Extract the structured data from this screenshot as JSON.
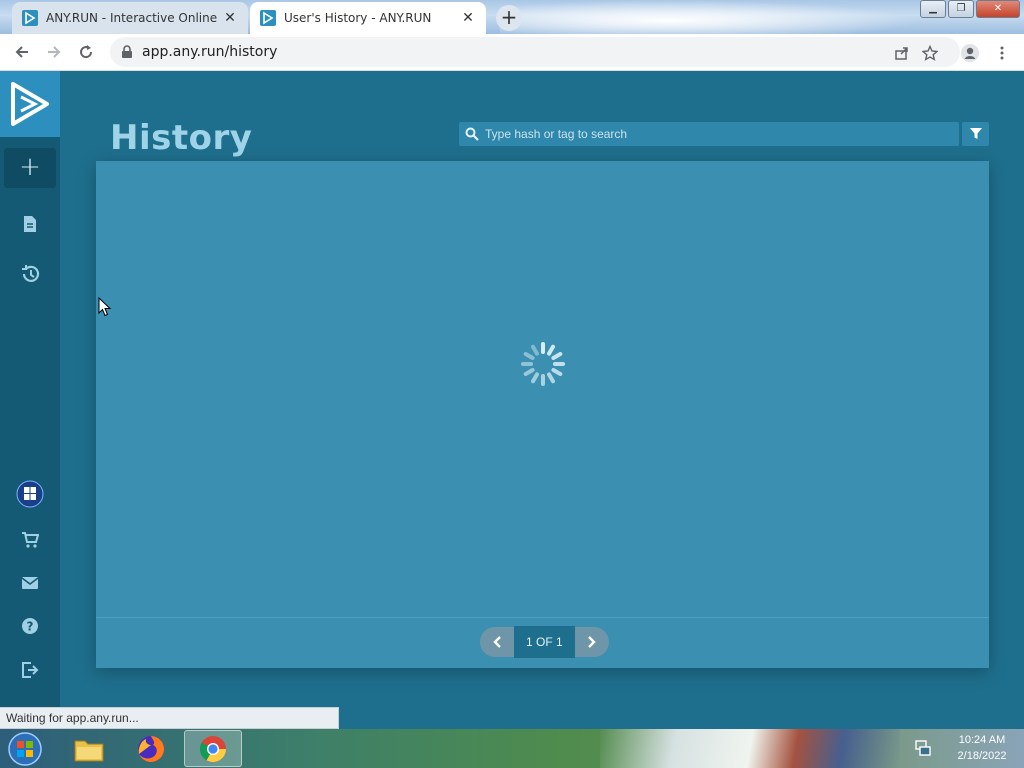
{
  "browser": {
    "tabs": [
      {
        "title": "ANY.RUN - Interactive Online Ma",
        "active": false
      },
      {
        "title": "User's History - ANY.RUN",
        "active": true
      }
    ],
    "url": "app.any.run/history"
  },
  "app": {
    "page_title": "History",
    "search": {
      "placeholder": "Type hash or tag to search",
      "value": ""
    },
    "pagination": {
      "label": "1 OF 1"
    },
    "status_bar": "Waiting for app.any.run...",
    "colors": {
      "accent": "#2c8fbd",
      "sidebar": "#145a75",
      "panel": "#3b8fb0",
      "background": "#1e6f8d"
    }
  },
  "taskbar": {
    "time": "10:24 AM",
    "date": "2/18/2022"
  },
  "icons": {
    "sidebar": [
      "plus-icon",
      "document-icon",
      "history-icon",
      "windows-icon",
      "cart-icon",
      "mail-icon",
      "help-icon",
      "logout-icon"
    ]
  }
}
